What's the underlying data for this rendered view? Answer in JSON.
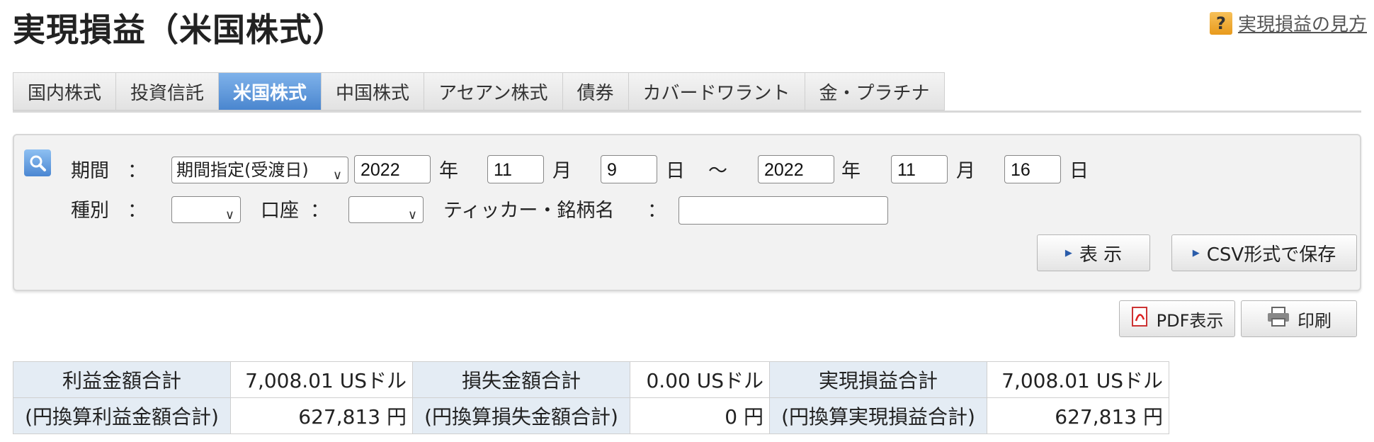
{
  "page": {
    "title": "実現損益（米国株式）",
    "help_link": "実現損益の見方",
    "help_icon": "question-icon"
  },
  "tabs": [
    {
      "label": "国内株式",
      "active": false
    },
    {
      "label": "投資信託",
      "active": false
    },
    {
      "label": "米国株式",
      "active": true
    },
    {
      "label": "中国株式",
      "active": false
    },
    {
      "label": "アセアン株式",
      "active": false
    },
    {
      "label": "債券",
      "active": false
    },
    {
      "label": "カバードワラント",
      "active": false
    },
    {
      "label": "金・プラチナ",
      "active": false
    }
  ],
  "search": {
    "period_label": "期間",
    "colon": "：",
    "period_type": "期間指定(受渡日)",
    "from_year": "2022",
    "from_month": "11",
    "from_day": "9",
    "to_year": "2022",
    "to_month": "11",
    "to_day": "16",
    "year_unit": "年",
    "month_unit": "月",
    "day_unit": "日",
    "tilde": "〜",
    "type_label": "種別",
    "type_value": "",
    "account_label": "口座",
    "account_value": "",
    "ticker_label": "ティッカー・銘柄名",
    "ticker_value": "",
    "show_button": "表 示",
    "csv_button": "CSV形式で保存"
  },
  "actions": {
    "pdf_button": "PDF表示",
    "print_button": "印刷"
  },
  "summary": {
    "row1": [
      {
        "label": "利益金額合計",
        "value": "7,008.01 USドル"
      },
      {
        "label": "損失金額合計",
        "value": "0.00 USドル"
      },
      {
        "label": "実現損益合計",
        "value": "7,008.01 USドル"
      }
    ],
    "row2": [
      {
        "label": "(円換算利益金額合計)",
        "value": "627,813 円"
      },
      {
        "label": "(円換算損失金額合計)",
        "value": "0 円"
      },
      {
        "label": "(円換算実現損益合計)",
        "value": "627,813 円"
      }
    ]
  },
  "colors": {
    "tab_active": "#4a86cf",
    "summary_header_bg": "#e4ecf4",
    "help_icon_bg": "#f0a830"
  }
}
